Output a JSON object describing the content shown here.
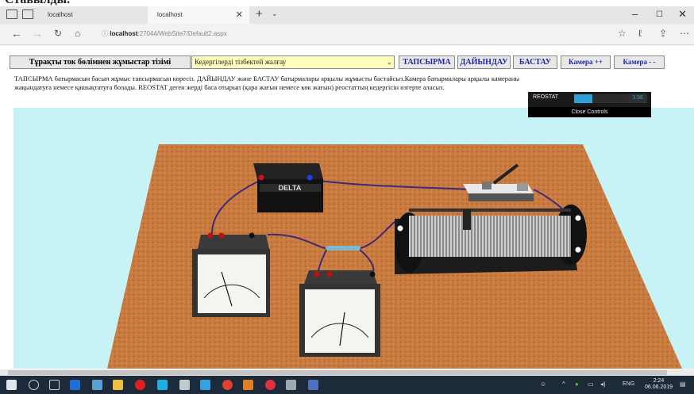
{
  "top_partial": "Ставылды.",
  "browser": {
    "tabs": [
      {
        "label": "localhost"
      },
      {
        "label": "localhost"
      }
    ],
    "url_host": "localhost",
    "url_path": ":27044/WebSite7/Default2.aspx"
  },
  "toolbar": {
    "list_button": "Тұрақты ток бөлімнен жұмыстар тізімі",
    "experiment_select": "Кедергілерді тізбектей жалғау",
    "task_button": "ТАПСЫРМА",
    "prepare_button": "ДАЙЫНДАУ",
    "start_button": "БАСТАУ",
    "camera_in": "Камера ++",
    "camera_out": "Камера - -"
  },
  "instructions": {
    "line1": "ТАПСЫРМА батырмасын басып жұмыс тапсырмасын көресіз. ДАЙЫНДАУ және БАСТАУ батырмалары арқылы жұмысты бастайсыз.Камера батырмалары арқылы камераны",
    "line2": "жақындатуға немесе қашықтатуға болады. REOSTAT деген жерді баса отырып (қара жағын немесе көк жағын) реостаттың кедергісін өзгерте аласыз."
  },
  "controls": {
    "label": "REOSTAT",
    "value": "3.56",
    "slider_fraction": 0.3,
    "close_label": "Close Controls"
  },
  "scene": {
    "battery_label": "DELTA"
  },
  "taskbar": {
    "lang": "ENG",
    "time": "2:24",
    "date": "06.06.2019"
  },
  "colors": {
    "scene_bg": "#c7f3f6",
    "table": "#c97b40",
    "gui_fill": "#2fa1d6",
    "select_bg": "#ffffbe"
  }
}
